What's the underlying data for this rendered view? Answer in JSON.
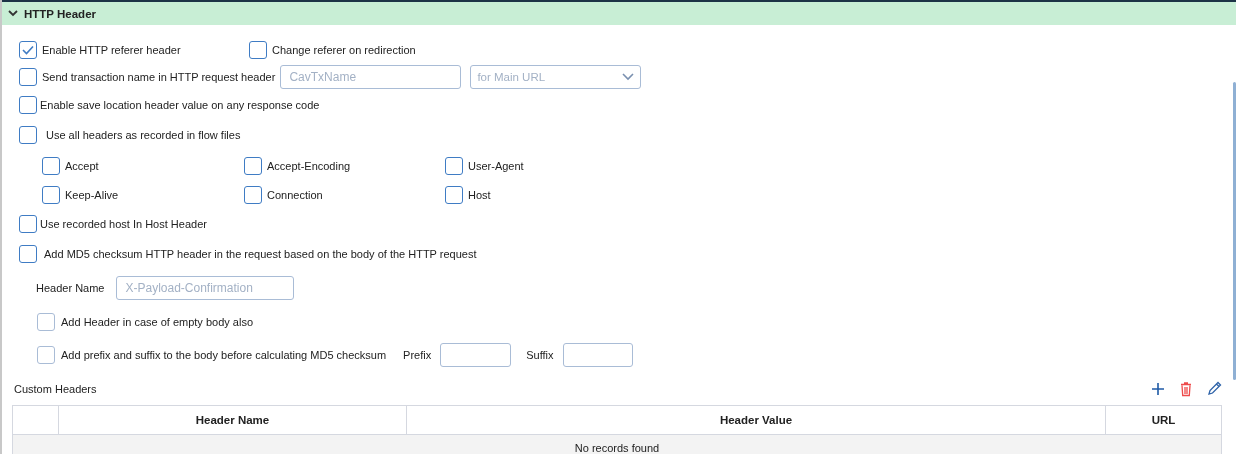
{
  "section": {
    "title": "HTTP Header",
    "expanded": true
  },
  "referer": [
    {
      "label": "Enable HTTP referer header",
      "checked": true
    },
    {
      "label": "Change referer on redirection",
      "checked": false
    }
  ],
  "transaction": {
    "label": "Send transaction name in HTTP request header",
    "checked": false,
    "placeholder": "CavTxName",
    "select": "for Main URL"
  },
  "save_location": {
    "label": "Enable save location header value on any response code",
    "checked": false
  },
  "use_all_headers": {
    "label": "Use all headers as recorded in flow files",
    "checked": false
  },
  "header_options": [
    {
      "label": "Accept",
      "checked": false
    },
    {
      "label": "Accept-Encoding",
      "checked": false
    },
    {
      "label": "User-Agent",
      "checked": false
    },
    {
      "label": "Keep-Alive",
      "checked": false
    },
    {
      "label": "Connection",
      "checked": false
    },
    {
      "label": "Host",
      "checked": false
    }
  ],
  "recorded_host": {
    "label": "Use recorded host In Host Header",
    "checked": false
  },
  "md5": {
    "label": "Add MD5 checksum HTTP header in the request based on the body of the HTTP request",
    "checked": false
  },
  "header_name": {
    "label": "Header Name",
    "placeholder": "X-Payload-Confirmation"
  },
  "empty_body": {
    "label": "Add Header in case of empty body also",
    "checked": false
  },
  "prefix_suffix": {
    "label": "Add prefix and suffix to the body before calculating MD5 checksum",
    "checked": false,
    "prefix_label": "Prefix",
    "suffix_label": "Suffix"
  },
  "custom_headers": {
    "title": "Custom Headers",
    "columns": [
      "Header Name",
      "Header Value",
      "URL"
    ],
    "empty_message": "No records found"
  }
}
